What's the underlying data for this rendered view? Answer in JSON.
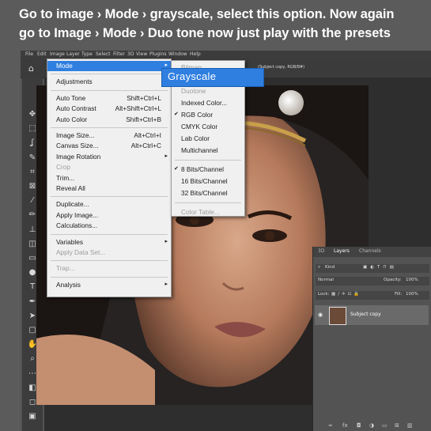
{
  "caption": {
    "line1": "Go to image › Mode › grayscale, select this option. Now again",
    "line2": "go to  Image › Mode › Duo tone now just play with the presets"
  },
  "menubar": [
    "File",
    "Edit",
    "Image",
    "Layer",
    "Type",
    "Select",
    "Filter",
    "3D",
    "View",
    "Plugins",
    "Window",
    "Help"
  ],
  "options_bar": {
    "info": "(Subject copy, RGB/8#)",
    "home_icon": "home-icon"
  },
  "image_menu": [
    {
      "label": "Mode",
      "shortcut": "",
      "submenu": true,
      "highlighted": true
    },
    {
      "sep": true
    },
    {
      "label": "Adjustments",
      "shortcut": "",
      "submenu": true
    },
    {
      "sep": true
    },
    {
      "label": "Auto Tone",
      "shortcut": "Shift+Ctrl+L"
    },
    {
      "label": "Auto Contrast",
      "shortcut": "Alt+Shift+Ctrl+L"
    },
    {
      "label": "Auto Color",
      "shortcut": "Shift+Ctrl+B"
    },
    {
      "sep": true
    },
    {
      "label": "Image Size...",
      "shortcut": "Alt+Ctrl+I"
    },
    {
      "label": "Canvas Size...",
      "shortcut": "Alt+Ctrl+C"
    },
    {
      "label": "Image Rotation",
      "shortcut": "",
      "submenu": true
    },
    {
      "label": "Crop",
      "shortcut": "",
      "disabled": true
    },
    {
      "label": "Trim...",
      "shortcut": ""
    },
    {
      "label": "Reveal All",
      "shortcut": ""
    },
    {
      "sep": true
    },
    {
      "label": "Duplicate...",
      "shortcut": ""
    },
    {
      "label": "Apply Image...",
      "shortcut": ""
    },
    {
      "label": "Calculations...",
      "shortcut": ""
    },
    {
      "sep": true
    },
    {
      "label": "Variables",
      "shortcut": "",
      "submenu": true
    },
    {
      "label": "Apply Data Set...",
      "shortcut": "",
      "disabled": true
    },
    {
      "sep": true
    },
    {
      "label": "Trap...",
      "shortcut": "",
      "disabled": true
    },
    {
      "sep": true
    },
    {
      "label": "Analysis",
      "shortcut": "",
      "submenu": true
    }
  ],
  "mode_submenu": [
    {
      "label": "Bitmap",
      "disabled": true
    },
    {
      "label": "Grayscale",
      "highlighted": true
    },
    {
      "label": "Duotone",
      "disabled": true
    },
    {
      "label": "Indexed Color..."
    },
    {
      "label": "RGB Color",
      "checked": true
    },
    {
      "label": "CMYK Color"
    },
    {
      "label": "Lab Color"
    },
    {
      "label": "Multichannel"
    },
    {
      "sep": true
    },
    {
      "label": "8 Bits/Channel",
      "checked": true
    },
    {
      "label": "16 Bits/Channel"
    },
    {
      "label": "32 Bits/Channel"
    },
    {
      "sep": true
    },
    {
      "label": "Color Table...",
      "disabled": true
    }
  ],
  "tools": [
    "move-icon",
    "marquee-icon",
    "lasso-icon",
    "quick-select-icon",
    "crop-icon",
    "frame-icon",
    "eyedropper-icon",
    "brush-icon",
    "stamp-icon",
    "eraser-icon",
    "gradient-icon",
    "dodge-icon",
    "type-icon",
    "pen-icon",
    "path-select-icon",
    "shape-icon",
    "hand-icon",
    "zoom-icon",
    "more-icon",
    "colors-icon",
    "quickmask-icon",
    "screenmode-icon"
  ],
  "layers_panel": {
    "tabs": [
      "3D",
      "Layers",
      "Channels"
    ],
    "active_tab": "Layers",
    "filter": "Kind",
    "blend_mode": "Normal",
    "opacity_label": "Opacity:",
    "opacity": "100%",
    "lock_label": "Lock:",
    "fill_label": "Fill:",
    "fill": "100%",
    "layer_name": "Subject copy"
  },
  "colors": {
    "accent": "#2f7fe0",
    "menu_bg": "#f0f0f0",
    "app_bg": "#535353"
  }
}
